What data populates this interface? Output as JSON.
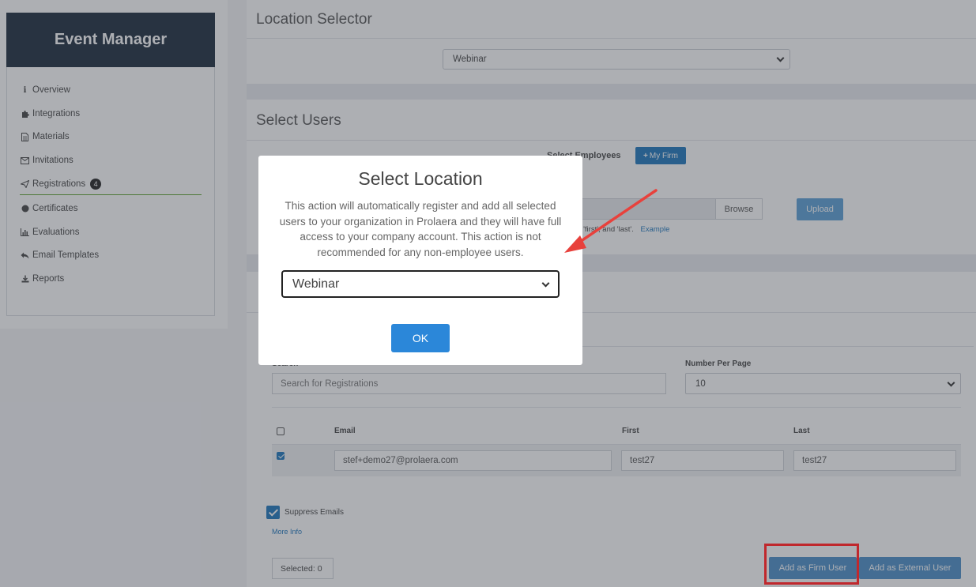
{
  "sidebar": {
    "title": "Event Manager",
    "items": [
      {
        "label": "Overview",
        "icon": "info-icon"
      },
      {
        "label": "Integrations",
        "icon": "puzzle-icon"
      },
      {
        "label": "Materials",
        "icon": "file-icon"
      },
      {
        "label": "Invitations",
        "icon": "envelope-icon"
      },
      {
        "label": "Registrations",
        "icon": "paper-plane-icon",
        "badge": "4"
      },
      {
        "label": "Certificates",
        "icon": "certificate-icon"
      },
      {
        "label": "Evaluations",
        "icon": "bar-chart-icon"
      },
      {
        "label": "Email Templates",
        "icon": "reply-icon"
      },
      {
        "label": "Reports",
        "icon": "download-icon"
      }
    ]
  },
  "location_selector": {
    "title": "Location Selector",
    "selected": "Webinar"
  },
  "select_users": {
    "title": "Select Users",
    "employees_label": "Select Employees",
    "my_firm_button": "My Firm",
    "browse_button": "Browse",
    "upload_button": "Upload",
    "hint_visible": "', 'first', and 'last'.",
    "example_link": "Example"
  },
  "registrations": {
    "search_label": "Search",
    "search_placeholder": "Search for Registrations",
    "per_page_label": "Number Per Page",
    "per_page_value": "10",
    "columns": [
      "Email",
      "First",
      "Last"
    ],
    "rows": [
      {
        "email": "stef+demo27@prolaera.com",
        "first": "test27",
        "last": "test27",
        "checked": true
      }
    ],
    "suppress_label": "Suppress Emails",
    "more_info": "More Info",
    "selected_count": "Selected: 0",
    "add_firm_button": "Add as Firm User",
    "add_external_button": "Add as External User"
  },
  "modal": {
    "title": "Select Location",
    "body": "This action will automatically register and add all selected users to your organization in Prolaera and they will have full access to your company account. This action is not recommended for any non-employee users.",
    "selected": "Webinar",
    "ok_button": "OK"
  },
  "colors": {
    "accent": "#1c75bc",
    "sidebar_header": "#1b2a3c",
    "annotation_red": "#e8413c",
    "highlight_box": "#c0282d"
  }
}
